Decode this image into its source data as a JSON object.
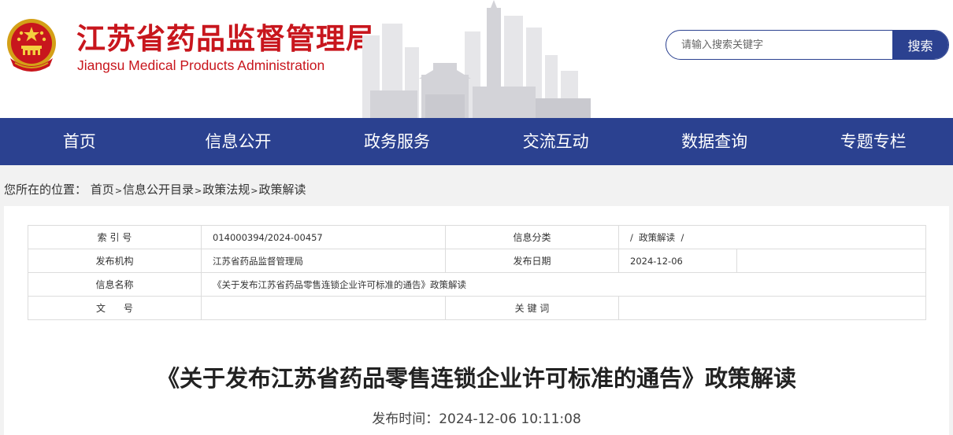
{
  "header": {
    "title": "江苏省药品监督管理局",
    "subtitle": "Jiangsu Medical Products Administration",
    "emblem_icon": "national-emblem-icon",
    "brand_color": "#c8161d",
    "search": {
      "placeholder": "请输入搜索关键字",
      "button_label": "搜索"
    }
  },
  "nav": {
    "color": "#2b4190",
    "items": [
      {
        "label": "首页"
      },
      {
        "label": "信息公开"
      },
      {
        "label": "政务服务"
      },
      {
        "label": "交流互动"
      },
      {
        "label": "数据查询"
      },
      {
        "label": "专题专栏"
      }
    ]
  },
  "breadcrumb": {
    "prefix": "您所在的位置：",
    "items": [
      "首页",
      "信息公开目录",
      "政策法规",
      "政策解读"
    ],
    "separator": ">"
  },
  "meta_table": {
    "index_label": "索 引 号",
    "index_value": "014000394/2024-00457",
    "category_label": "信息分类",
    "category_value": "/  政策解读  /",
    "publisher_label": "发布机构",
    "publisher_value": "江苏省药品监督管理局",
    "date_label": "发布日期",
    "date_value": "2024-12-06",
    "name_label": "信息名称",
    "name_value": "《关于发布江苏省药品零售连锁企业许可标准的通告》政策解读",
    "doc_no_label": "文      号",
    "doc_no_value": "",
    "keywords_label": "关 键 词",
    "keywords_value": ""
  },
  "article": {
    "title": "《关于发布江苏省药品零售连锁企业许可标准的通告》政策解读",
    "publish_time": "发布时间：2024-12-06 10:11:08"
  }
}
